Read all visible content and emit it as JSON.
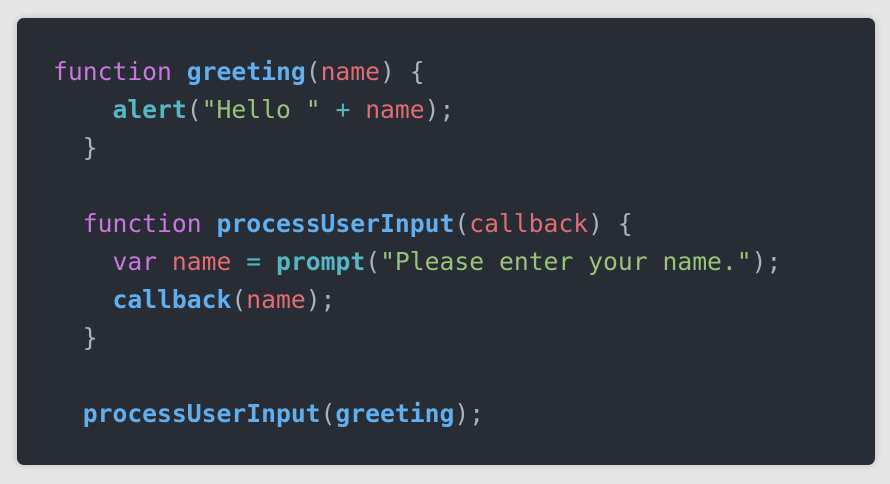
{
  "colors": {
    "background": "#e6e6e6",
    "panel": "#282c34",
    "keyword": "#c678dd",
    "function": "#61afef",
    "builtin": "#56b6c2",
    "variable": "#e06c75",
    "string": "#98c379",
    "punctuation": "#abb2bf"
  },
  "code": {
    "lines": [
      [
        {
          "t": "kw",
          "v": "function"
        },
        {
          "t": "pn",
          "v": " "
        },
        {
          "t": "fn",
          "v": "greeting"
        },
        {
          "t": "pn",
          "v": "("
        },
        {
          "t": "var",
          "v": "name"
        },
        {
          "t": "pn",
          "v": ") {"
        }
      ],
      [
        {
          "t": "pn",
          "v": "    "
        },
        {
          "t": "bi",
          "v": "alert"
        },
        {
          "t": "pn",
          "v": "("
        },
        {
          "t": "str",
          "v": "\"Hello \""
        },
        {
          "t": "pn",
          "v": " "
        },
        {
          "t": "op",
          "v": "+"
        },
        {
          "t": "pn",
          "v": " "
        },
        {
          "t": "var",
          "v": "name"
        },
        {
          "t": "pn",
          "v": ");"
        }
      ],
      [
        {
          "t": "pn",
          "v": "  }"
        }
      ],
      [],
      [
        {
          "t": "pn",
          "v": "  "
        },
        {
          "t": "kw",
          "v": "function"
        },
        {
          "t": "pn",
          "v": " "
        },
        {
          "t": "fn",
          "v": "processUserInput"
        },
        {
          "t": "pn",
          "v": "("
        },
        {
          "t": "var",
          "v": "callback"
        },
        {
          "t": "pn",
          "v": ") {"
        }
      ],
      [
        {
          "t": "pn",
          "v": "    "
        },
        {
          "t": "kw",
          "v": "var"
        },
        {
          "t": "pn",
          "v": " "
        },
        {
          "t": "var",
          "v": "name"
        },
        {
          "t": "pn",
          "v": " "
        },
        {
          "t": "op",
          "v": "="
        },
        {
          "t": "pn",
          "v": " "
        },
        {
          "t": "bi",
          "v": "prompt"
        },
        {
          "t": "pn",
          "v": "("
        },
        {
          "t": "str",
          "v": "\"Please enter your name.\""
        },
        {
          "t": "pn",
          "v": ");"
        }
      ],
      [
        {
          "t": "pn",
          "v": "    "
        },
        {
          "t": "fn",
          "v": "callback"
        },
        {
          "t": "pn",
          "v": "("
        },
        {
          "t": "var",
          "v": "name"
        },
        {
          "t": "pn",
          "v": ");"
        }
      ],
      [
        {
          "t": "pn",
          "v": "  }"
        }
      ],
      [],
      [
        {
          "t": "pn",
          "v": "  "
        },
        {
          "t": "fn",
          "v": "processUserInput"
        },
        {
          "t": "pn",
          "v": "("
        },
        {
          "t": "fn",
          "v": "greeting"
        },
        {
          "t": "pn",
          "v": ");"
        }
      ]
    ]
  }
}
